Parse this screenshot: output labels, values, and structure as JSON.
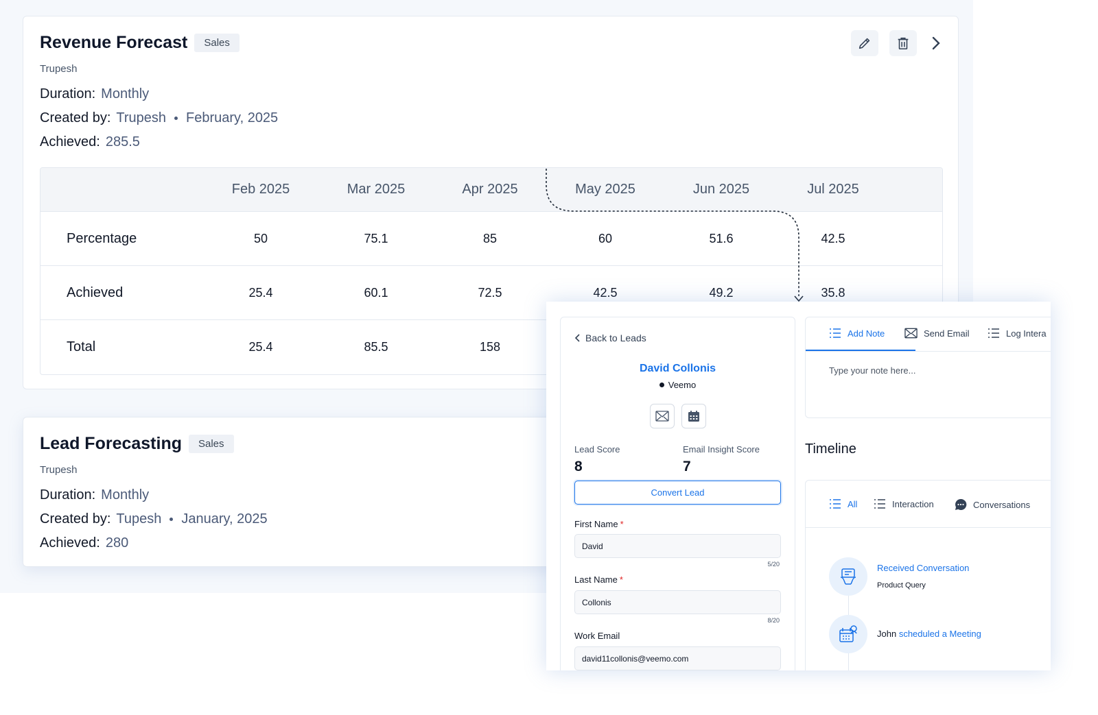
{
  "revenue_card": {
    "title": "Revenue Forecast",
    "tag": "Sales",
    "owner": "Trupesh",
    "duration_label": "Duration:",
    "duration_value": "Monthly",
    "created_label": "Created by:",
    "created_by": "Trupesh",
    "created_date": "February, 2025",
    "achieved_label": "Achieved:",
    "achieved_value": "285.5",
    "actions": {
      "edit": "pencil-icon",
      "delete": "trash-icon",
      "next": "chevron-right-icon"
    },
    "table": {
      "columns": [
        "Feb 2025",
        "Mar 2025",
        "Apr 2025",
        "May 2025",
        "Jun 2025",
        "Jul 2025"
      ],
      "rows": [
        {
          "label": "Percentage",
          "cells": [
            "50",
            "75.1",
            "85",
            "60",
            "51.6",
            "42.5"
          ]
        },
        {
          "label": "Achieved",
          "cells": [
            "25.4",
            "60.1",
            "72.5",
            "42.5",
            "49.2",
            "35.8"
          ]
        },
        {
          "label": "Total",
          "cells": [
            "25.4",
            "85.5",
            "158",
            "",
            "",
            ""
          ]
        }
      ]
    }
  },
  "lead_card": {
    "title": "Lead Forecasting",
    "tag": "Sales",
    "owner": "Trupesh",
    "duration_label": "Duration:",
    "duration_value": "Monthly",
    "created_label": "Created by:",
    "created_by": "Tupesh",
    "created_date": "January, 2025",
    "achieved_label": "Achieved:",
    "achieved_value": "280"
  },
  "lead_detail": {
    "back_label": "Back to Leads",
    "name": "David Collonis",
    "company": "Veemo",
    "lead_score_label": "Lead Score",
    "lead_score": "8",
    "email_score_label": "Email Insight Score",
    "email_score": "7",
    "convert_label": "Convert Lead",
    "fields": {
      "first_name": {
        "label": "First Name",
        "value": "David",
        "count": "5/20"
      },
      "last_name": {
        "label": "Last Name",
        "value": "Collonis",
        "count": "8/20"
      },
      "work_email": {
        "label": "Work Email",
        "value": "david11collonis@veemo.com"
      }
    },
    "tabs": {
      "add_note": "Add Note",
      "send_email": "Send Email",
      "log": "Log Intera"
    },
    "note_placeholder": "Type your note here...",
    "timeline_title": "Timeline",
    "timeline_tabs": {
      "all": "All",
      "interaction": "Interaction",
      "conversations": "Conversations"
    },
    "timeline_items": {
      "item1_title": "Received Conversation",
      "item1_sub": "Product Query",
      "item2_user": "John",
      "item2_action": "scheduled a Meeting"
    }
  },
  "colors": {
    "accent": "#1a73e8",
    "muted_value": "#4b5a78",
    "background": "#f5f8fc"
  }
}
